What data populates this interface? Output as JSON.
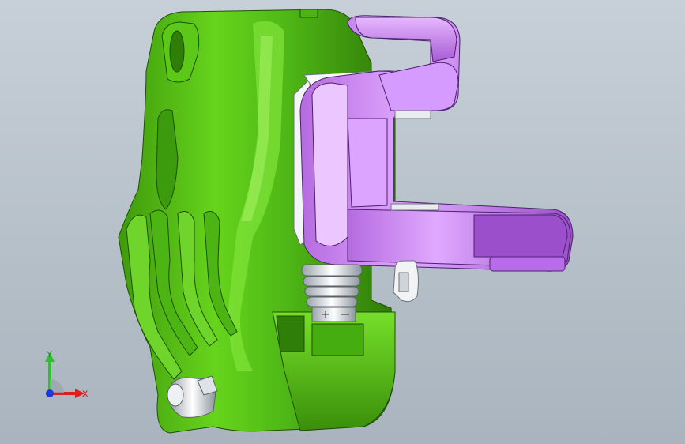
{
  "viewport": {
    "background_top": "#c7d0d8",
    "background_bottom": "#a9b4be"
  },
  "model": {
    "caliper_body_color": "#58c818",
    "bracket_color": "#c77ef0",
    "hardware_color": "#e9ecef"
  },
  "triad": {
    "x_label": "X",
    "y_label": "Y",
    "x_color": "#e21d1d",
    "y_color": "#2fbf2f",
    "z_color": "#1f38d6"
  }
}
